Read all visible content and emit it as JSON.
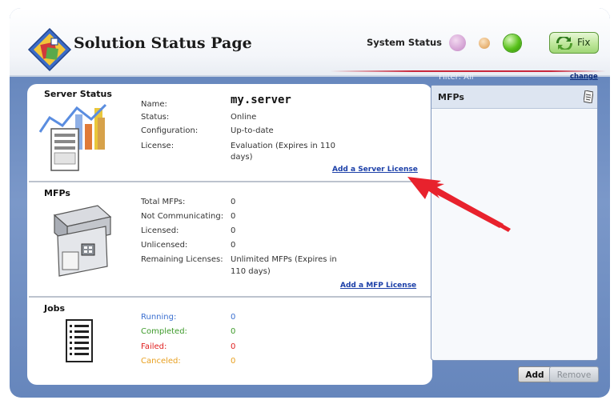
{
  "header": {
    "title": "Solution Status Page",
    "system_status_label": "System Status",
    "fix_label": "Fix"
  },
  "server_status": {
    "section_title": "Server Status",
    "name_label": "Name:",
    "name_value": "my.server",
    "status_label": "Status:",
    "status_value": "Online",
    "configuration_label": "Configuration:",
    "configuration_value": "Up-to-date",
    "license_label": "License:",
    "license_value_line1": "Evaluation (Expires in 110",
    "license_value_line2": "days)",
    "add_license_link": "Add a Server License"
  },
  "mfps": {
    "section_title": "MFPs",
    "rows": [
      {
        "label": "Total MFPs:",
        "value": "0"
      },
      {
        "label": "Not Communicating:",
        "value": "0"
      },
      {
        "label": "Licensed:",
        "value": "0"
      },
      {
        "label": "Unlicensed:",
        "value": "0"
      }
    ],
    "remaining_label": "Remaining Licenses:",
    "remaining_value_line1": "Unlimited MFPs  (Expires in",
    "remaining_value_line2": "110 days)",
    "add_license_link": "Add a MFP License"
  },
  "jobs": {
    "section_title": "Jobs",
    "rows": [
      {
        "label": "Running:",
        "value": "0",
        "color": "#3a6fd0"
      },
      {
        "label": "Completed:",
        "value": "0",
        "color": "#3d9a2a"
      },
      {
        "label": "Failed:",
        "value": "0",
        "color": "#e02020"
      },
      {
        "label": "Canceled:",
        "value": "0",
        "color": "#e8a020"
      }
    ]
  },
  "right_panel": {
    "filter_label": "Filter: All",
    "change_link": "change",
    "list_title": "MFPs",
    "add_button": "Add",
    "remove_button": "Remove"
  },
  "colors": {
    "status_green": "#5ac21b",
    "status_purple": "#d6a6d6",
    "status_orange": "#e9b679",
    "link_blue": "#1b3fa8",
    "annotation_arrow": "#e8222d"
  },
  "icons": [
    "app-logo-icon",
    "fix-icon",
    "server-chart-icon",
    "printer-icon",
    "job-list-icon",
    "filter-page-icon",
    "annotation-arrow"
  ]
}
